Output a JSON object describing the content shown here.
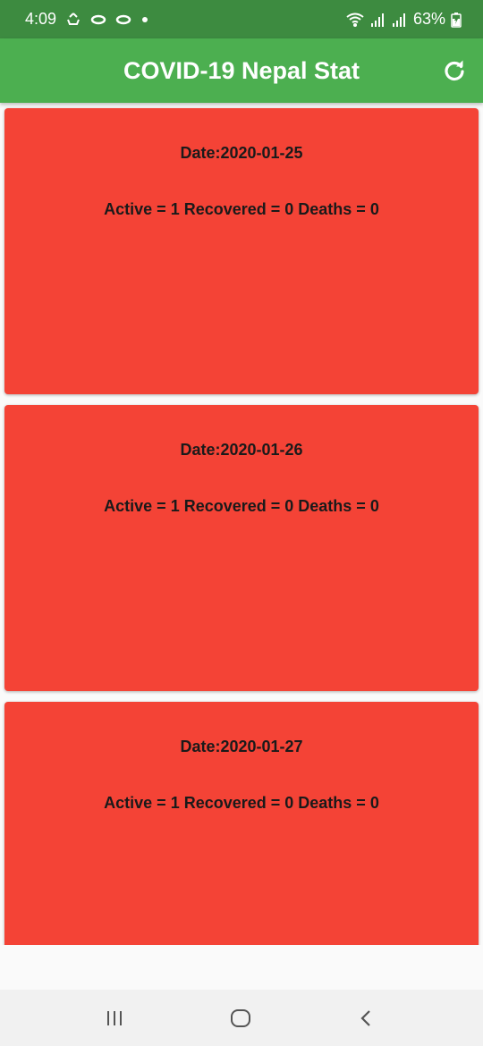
{
  "status_bar": {
    "time": "4:09",
    "battery": "63%",
    "icons": [
      "sync-icon",
      "app-icon",
      "app-icon",
      "notification-dot-icon",
      "wifi-icon",
      "signal-icon",
      "signal-icon",
      "battery-charging-icon"
    ]
  },
  "app_bar": {
    "title": "COVID-19 Nepal Stat",
    "action_icon": "refresh-icon"
  },
  "colors": {
    "status_bar": "#3d8b40",
    "app_bar": "#4caf50",
    "card": "#f44336",
    "background": "#fafafa"
  },
  "cards": [
    {
      "date": "Date:2020-01-25",
      "stats": "Active = 1 Recovered = 0 Deaths = 0"
    },
    {
      "date": "Date:2020-01-26",
      "stats": "Active = 1 Recovered = 0 Deaths = 0"
    },
    {
      "date": "Date:2020-01-27",
      "stats": "Active = 1 Recovered = 0 Deaths = 0"
    }
  ],
  "nav_bar": {
    "icons": [
      "recent-apps-icon",
      "home-icon",
      "back-icon"
    ]
  }
}
